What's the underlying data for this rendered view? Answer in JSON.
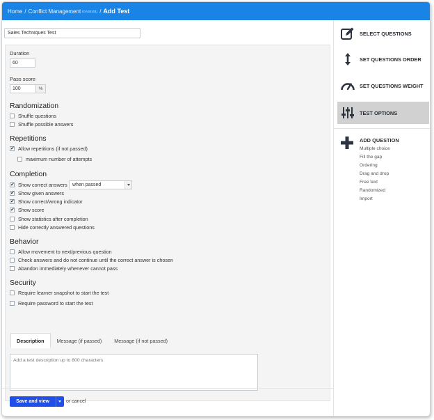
{
  "breadcrumb": {
    "home": "Home",
    "sep": "/",
    "course": "Conflict Management",
    "course_code": "(GA30101)",
    "current": "Add Test"
  },
  "test": {
    "name": "Sales Techniques Test"
  },
  "duration": {
    "label": "Duration",
    "value": "60"
  },
  "pass_score": {
    "label": "Pass score",
    "value": "100",
    "unit": "%"
  },
  "randomization": {
    "title": "Randomization",
    "items": [
      {
        "label": "Shuffle questions",
        "checked": false
      },
      {
        "label": "Shuffle possible answers",
        "checked": false
      }
    ]
  },
  "repetitions": {
    "title": "Repetitions",
    "items": [
      {
        "label": "Allow repetitions (if not passed)",
        "checked": true
      },
      {
        "label": "maximum number of attempts",
        "checked": false
      }
    ]
  },
  "completion": {
    "title": "Completion",
    "show_correct_select": "when passed",
    "items": [
      {
        "label": "Show correct answers",
        "checked": true
      },
      {
        "label": "Show given answers",
        "checked": true
      },
      {
        "label": "Show correct/wrong indicator",
        "checked": true
      },
      {
        "label": "Show score",
        "checked": true
      },
      {
        "label": "Show statistics after completion",
        "checked": false
      },
      {
        "label": "Hide correctly answered questions",
        "checked": false
      }
    ]
  },
  "behavior": {
    "title": "Behavior",
    "items": [
      {
        "label": "Allow movement to next/previous question",
        "checked": false
      },
      {
        "label": "Check answers and do not continue until the correct answer is chosen",
        "checked": false
      },
      {
        "label": "Abandon immediately whenever cannot pass",
        "checked": false
      }
    ]
  },
  "security": {
    "title": "Security",
    "items": [
      {
        "label": "Require learner snapshot to start the test",
        "checked": false
      },
      {
        "label": "Require password to start the test",
        "checked": false
      }
    ]
  },
  "tabs": [
    {
      "label": "Description",
      "active": true
    },
    {
      "label": "Message (if passed)",
      "active": false
    },
    {
      "label": "Message (if not passed)",
      "active": false
    }
  ],
  "description_placeholder": "Add a test description up to 800 characters",
  "footer": {
    "save_label": "Save and view",
    "cancel_label": "or cancel"
  },
  "sidebar": {
    "items": [
      {
        "label": "SELECT QUESTIONS",
        "icon": "edit-icon",
        "active": false
      },
      {
        "label": "SET QUESTIONS ORDER",
        "icon": "vertical-arrows-icon",
        "active": false
      },
      {
        "label": "SET QUESTIONS WEIGHT",
        "icon": "gauge-icon",
        "active": false
      },
      {
        "label": "TEST OPTIONS",
        "icon": "sliders-icon",
        "active": true
      }
    ],
    "add_question": {
      "title": "ADD QUESTION",
      "icon": "plus-icon",
      "types": [
        "Multiple choice",
        "Fill the gap",
        "Ordering",
        "Drag and drop",
        "Free text",
        "Randomized",
        "Import"
      ]
    }
  },
  "colors": {
    "topbar": "#1a84e6",
    "primary_button": "#1f4ee8",
    "active_sidebar": "#d1d1d1"
  }
}
